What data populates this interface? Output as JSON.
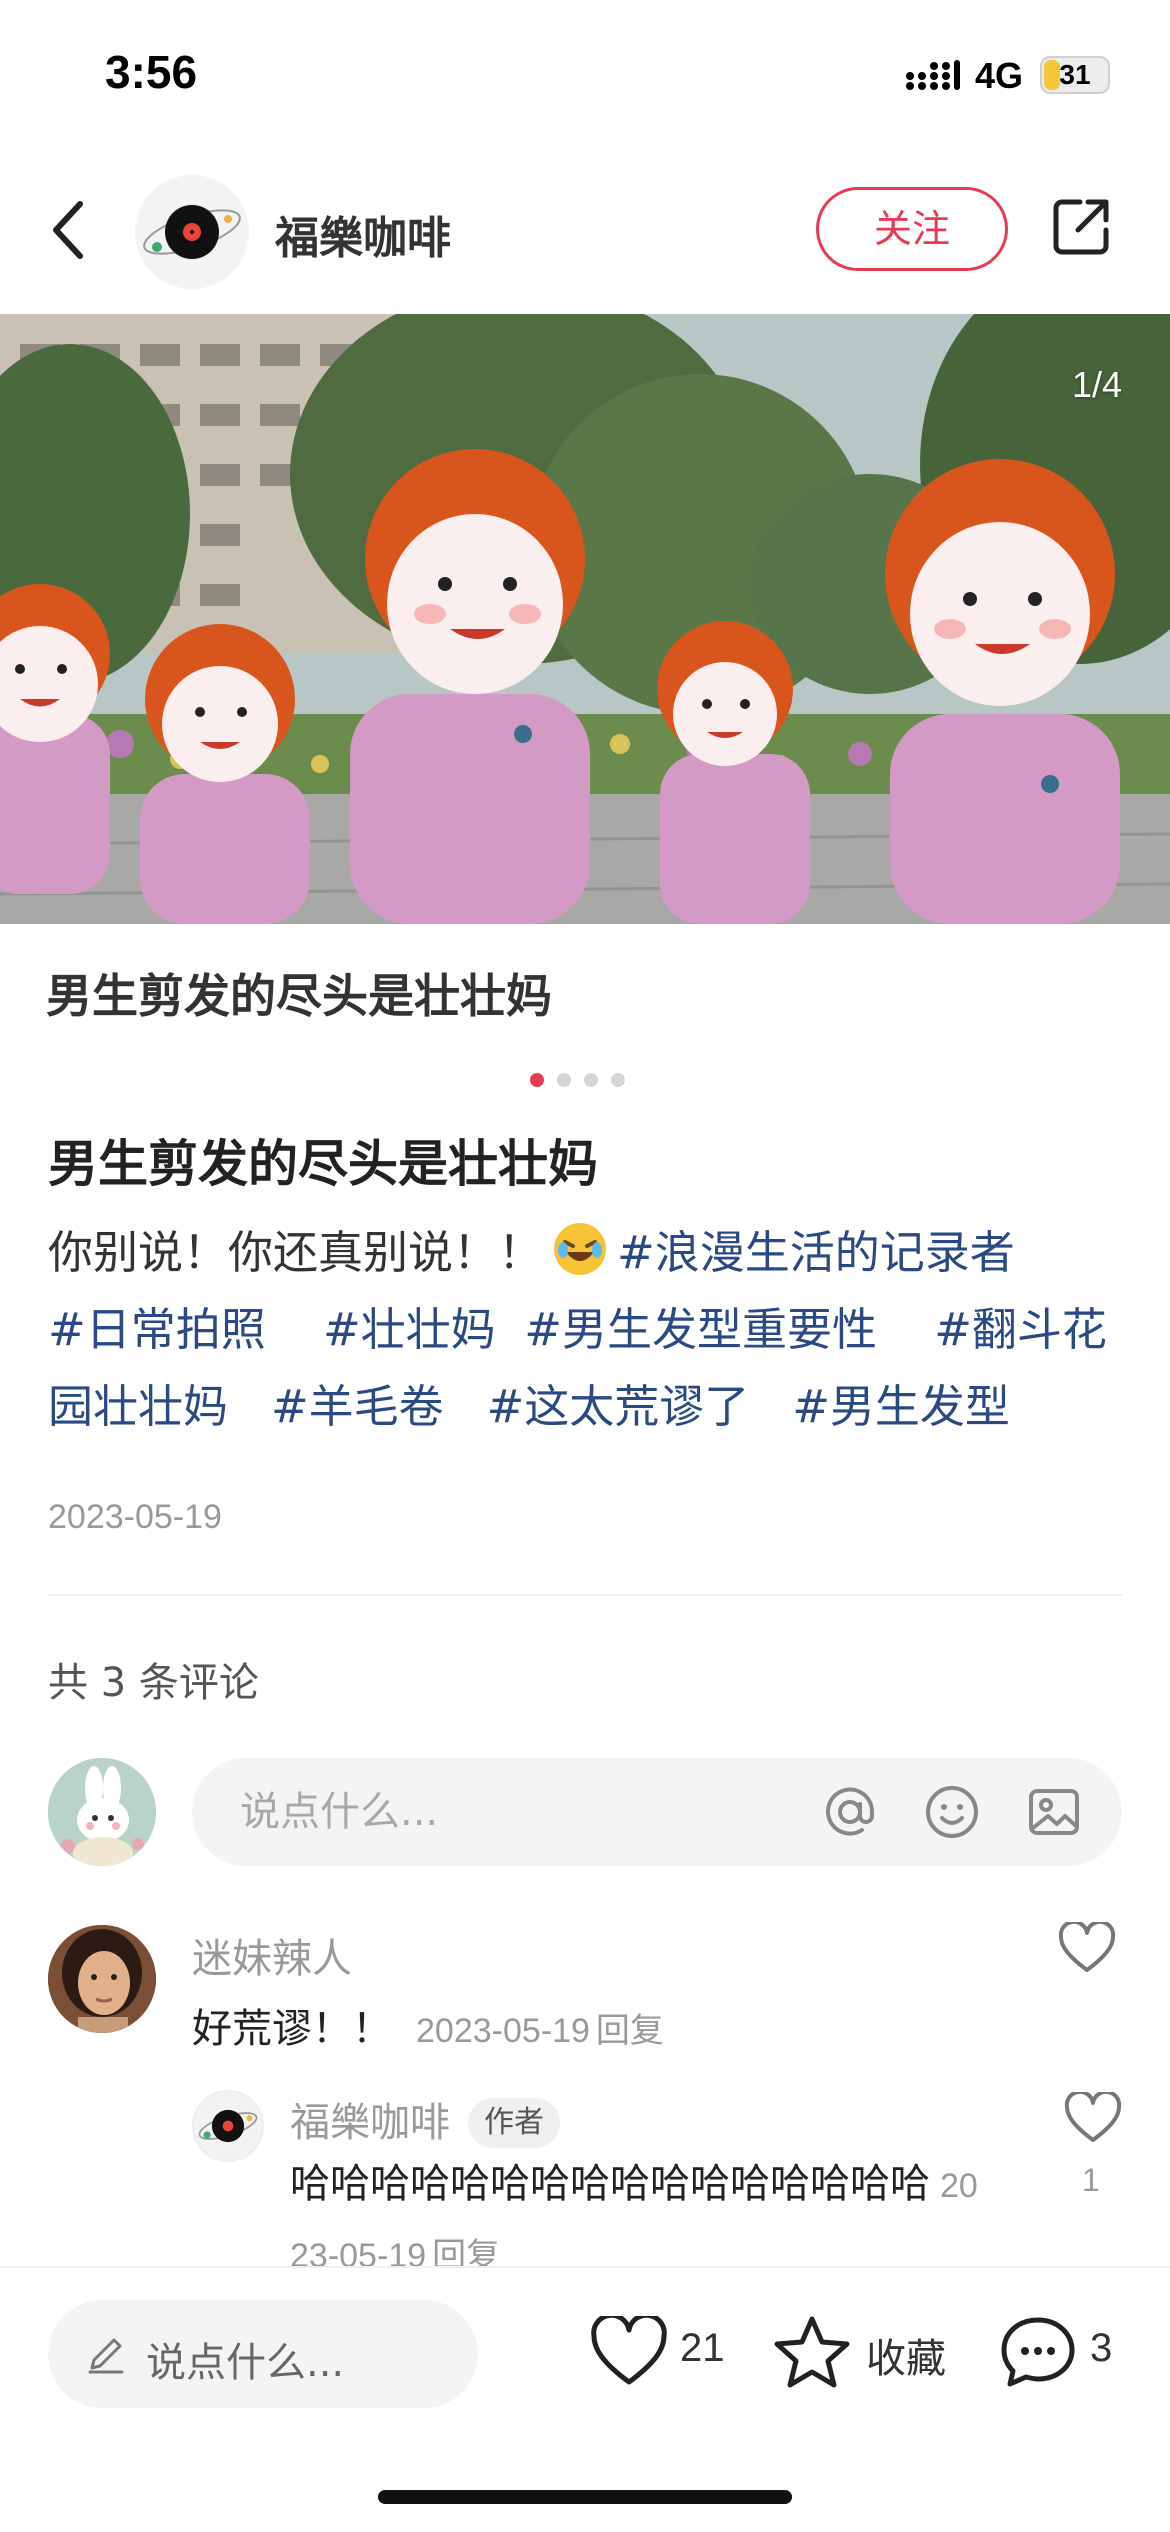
{
  "status_bar": {
    "time": "3:56",
    "network": "4G",
    "battery": "31",
    "battery_level_percent": 31
  },
  "header": {
    "author_name": "福樂咖啡",
    "follow_label": "关注"
  },
  "gallery": {
    "counter": "1/4",
    "caption": "男生剪发的尽头是壮壮妈",
    "page_count": 4,
    "active_index": 0
  },
  "post": {
    "title": "男生剪发的尽头是壮壮妈",
    "text": "你别说！你还真别说！！",
    "tags": [
      "#浪漫生活的记录者",
      "#日常拍照",
      "#壮壮妈",
      "#男生发型重要性",
      "#翻斗花园壮壮妈",
      "#羊毛卷",
      "#这太荒谬了",
      "#男生发型"
    ],
    "date": "2023-05-19"
  },
  "comments_section": {
    "count_label": "共 3 条评论",
    "input_placeholder": "说点什么...",
    "comments": [
      {
        "user": "迷妹辣人",
        "text": "好荒谬！！",
        "date": "2023-05-19",
        "reply_label": "回复",
        "replies": [
          {
            "user": "福樂咖啡",
            "badge": "作者",
            "text": "哈哈哈哈哈哈哈哈哈哈哈哈哈哈哈哈",
            "date": "2023-05-19",
            "reply_label": "回复",
            "likes": "1"
          }
        ]
      }
    ]
  },
  "bottom_bar": {
    "input_placeholder": "说点什么...",
    "likes": "21",
    "favorite_label": "收藏",
    "comments": "3"
  },
  "colors": {
    "accent": "#e63a55",
    "tag": "#2b4a84",
    "muted": "#999999"
  }
}
